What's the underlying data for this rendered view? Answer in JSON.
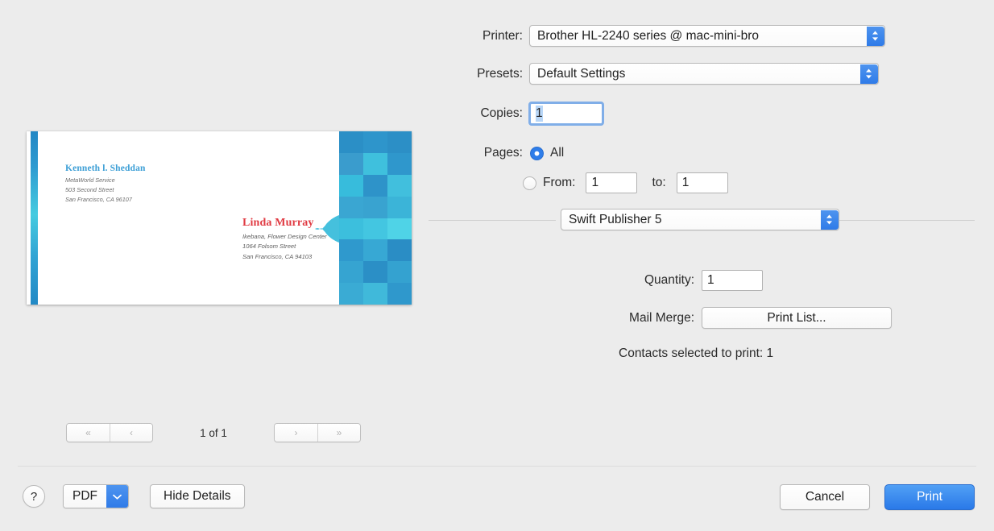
{
  "printer": {
    "label": "Printer:",
    "value": "Brother HL-2240 series @ mac-mini-bro"
  },
  "presets": {
    "label": "Presets:",
    "value": "Default Settings"
  },
  "copies": {
    "label": "Copies:",
    "value": "1"
  },
  "pages": {
    "label": "Pages:",
    "all_label": "All",
    "from_label": "From:",
    "from_value": "1",
    "to_label": "to:",
    "to_value": "1",
    "selected": "all"
  },
  "module": {
    "value": "Swift Publisher 5"
  },
  "quantity": {
    "label": "Quantity:",
    "value": "1"
  },
  "mail_merge": {
    "label": "Mail Merge:",
    "button_label": "Print List..."
  },
  "contacts_note": "Contacts selected to print: 1",
  "pager": {
    "first_icon": "«",
    "prev_icon": "‹",
    "next_icon": "›",
    "last_icon": "»",
    "position": "1 of 1"
  },
  "bottom": {
    "help_label": "?",
    "pdf_label": "PDF",
    "details_label": "Hide Details",
    "cancel_label": "Cancel",
    "print_label": "Print"
  },
  "envelope": {
    "from": {
      "name": "Kenneth l. Sheddan",
      "lines": [
        "MetaWorld Service",
        "503 Second Street",
        "San Francisco, CA 96107"
      ],
      "name_color": "#3d9fd6"
    },
    "to": {
      "name": "Linda Murray",
      "lines": [
        "Ikebana, Flower Design Center",
        "1064 Folsom Street",
        "San Francisco, CA 94103"
      ],
      "name_color": "#e03a42"
    },
    "mosaic_colors": [
      "#2b8fc6",
      "#2e95cb",
      "#2c8fc6",
      "#3a9ccd",
      "#3fc0dd",
      "#2f97cc",
      "#37bcdc",
      "#2e93c9",
      "#41bfdd",
      "#3aa6d2",
      "#39a3d0",
      "#3bb4d8",
      "#3cbfdd",
      "#43c6e1",
      "#4fd3e7",
      "#2f99cd",
      "#37a8d4",
      "#2a8dc5",
      "#36a4d1",
      "#2b8fc6",
      "#34a2d0",
      "#3aabd4",
      "#40b9da",
      "#2f98cc"
    ],
    "arrow_color": "#45c0dd"
  },
  "colors": {
    "accent": "#2f7be8",
    "window_bg": "#ececec",
    "default_button": "#3a86ee"
  }
}
